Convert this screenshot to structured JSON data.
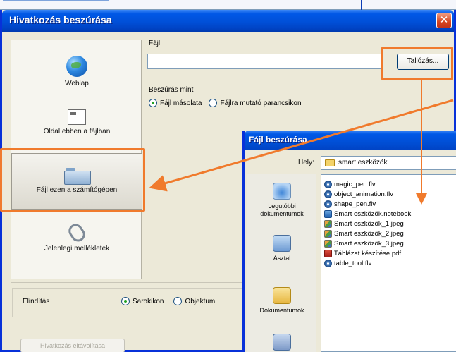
{
  "dialog": {
    "title": "Hivatkozás beszúrása",
    "close_glyph": "✕"
  },
  "link_to": {
    "items": [
      {
        "label": "Weblap",
        "icon": "globe-icon"
      },
      {
        "label": "Oldal ebben a fájlban",
        "icon": "page-icon"
      },
      {
        "label": "Fájl ezen a számítógépen",
        "icon": "folder-icon",
        "selected": true
      },
      {
        "label": "Jelenlegi mellékletek",
        "icon": "paperclip-icon"
      }
    ]
  },
  "file_field": {
    "label": "Fájl",
    "value": "",
    "browse_label": "Tallózás..."
  },
  "insert_as": {
    "label": "Beszúrás mint",
    "options": [
      {
        "label": "Fájl másolata",
        "selected": true
      },
      {
        "label": "Fájlra mutató parancsikon",
        "selected": false
      }
    ]
  },
  "start": {
    "label": "Elindítás",
    "options": [
      {
        "label": "Sarokikon",
        "selected": true
      },
      {
        "label": "Objektum",
        "selected": false
      }
    ]
  },
  "remove_link_button": "Hivatkozás eltávolítása",
  "file_dialog": {
    "title": "Fájl beszúrása",
    "look_in_label": "Hely:",
    "look_in_value": "smart eszközök",
    "places": [
      {
        "label": "Legutóbbi dokumentumok",
        "icon": "recent-documents-icon"
      },
      {
        "label": "Asztal",
        "icon": "desktop-icon"
      },
      {
        "label": "Dokumentumok",
        "icon": "documents-icon"
      },
      {
        "label": "",
        "icon": "my-computer-icon"
      }
    ],
    "files": [
      {
        "name": "magic_pen.flv",
        "type": "flv"
      },
      {
        "name": "object_animation.flv",
        "type": "flv"
      },
      {
        "name": "shape_pen.flv",
        "type": "flv"
      },
      {
        "name": "Smart eszközök.notebook",
        "type": "notebook"
      },
      {
        "name": "Smart eszközök_1.jpeg",
        "type": "jpeg"
      },
      {
        "name": "Smart eszközök_2.jpeg",
        "type": "jpeg"
      },
      {
        "name": "Smart eszközök_3.jpeg",
        "type": "jpeg"
      },
      {
        "name": "Táblázat készítése.pdf",
        "type": "pdf"
      },
      {
        "name": "table_tool.flv",
        "type": "flv"
      }
    ]
  },
  "colors": {
    "titlebar": "#0050d8",
    "annotation": "#f07a2c",
    "dialog_bg": "#ece9d8"
  }
}
